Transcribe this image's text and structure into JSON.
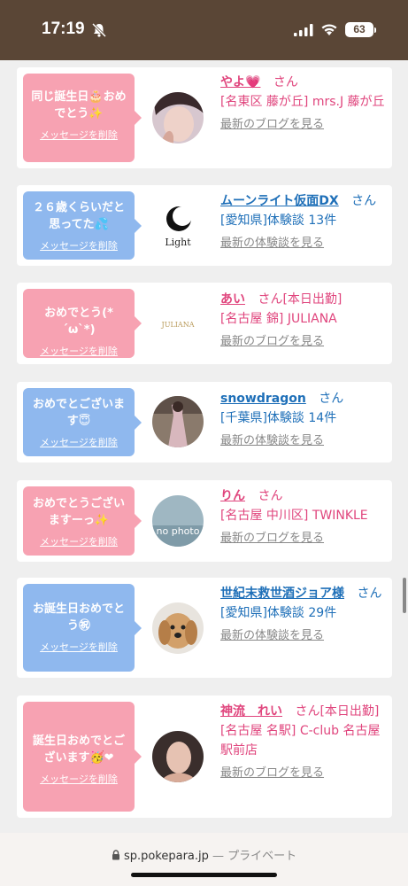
{
  "status_bar": {
    "time": "17:19",
    "battery": "63"
  },
  "cards": [
    {
      "bubble": "同じ誕生日🎂おめでとう✨",
      "delete": "メッセージを削除",
      "name": "やよ💗",
      "san": "さん",
      "extra": "",
      "detail": "[名東区 藤が丘] mrs.J 藤が丘",
      "link": "最新のブログを見る"
    },
    {
      "bubble": "２６歳くらいだと思ってた💦",
      "delete": "メッセージを削除",
      "name": "ムーンライト仮面DX",
      "san": "さん",
      "extra": "",
      "detail": "[愛知県]体験談 13件",
      "link": "最新の体験談を見る"
    },
    {
      "bubble": "おめでとう(*´ω`*)",
      "delete": "メッセージを削除",
      "name": "あい",
      "san": "さん",
      "extra": "[本日出勤]",
      "detail": "[名古屋 錦] JULIANA",
      "link": "最新のブログを見る"
    },
    {
      "bubble": "おめでとございます😇",
      "delete": "メッセージを削除",
      "name": "snowdragon",
      "san": "さん",
      "extra": "",
      "detail": "[千葉県]体験談 14件",
      "link": "最新の体験談を見る"
    },
    {
      "bubble": "おめでとうございますーっ✨",
      "delete": "メッセージを削除",
      "name": "りん",
      "san": "さん",
      "extra": "",
      "detail": "[名古屋 中川区] TWINKLE",
      "link": "最新のブログを見る"
    },
    {
      "bubble": "お誕生日おめでとう㊗",
      "delete": "メッセージを削除",
      "name": "世紀末救世酒ジョア様",
      "san": "さん",
      "extra": "",
      "detail": "[愛知県]体験談 29件",
      "link": "最新の体験談を見る"
    },
    {
      "bubble": "誕生日おめでとございます🥳❤",
      "delete": "メッセージを削除",
      "name": "神流　れい",
      "san": "さん",
      "extra": "[本日出勤]",
      "detail": "[名古屋 名駅] C-club 名古屋駅前店",
      "link": "最新のブログを見る"
    }
  ],
  "avatar_labels": {
    "moonlight_logo": "Light",
    "juliana_logo": "JULIANA",
    "no_photo": "no photo"
  },
  "url_bar": {
    "domain": "sp.pokepara.jp",
    "separator": "—",
    "mode": "プライベート"
  }
}
